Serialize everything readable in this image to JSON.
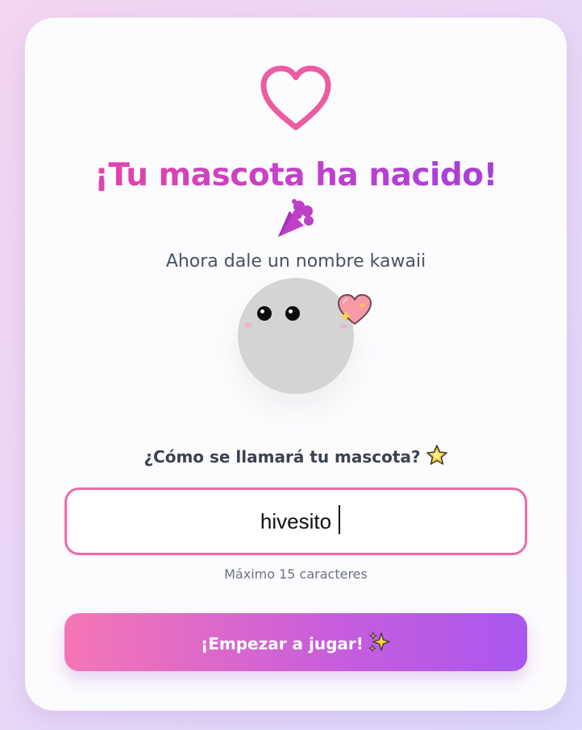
{
  "card": {
    "title": "¡Tu mascota ha nacido!",
    "subtitle": "Ahora dale un nombre kawaii",
    "question": "¿Cómo se llamará tu mascota?",
    "name_input": {
      "value": "hivesito",
      "placeholder": ""
    },
    "helper": "Máximo 15 caracteres",
    "start_button": "¡Empezar a jugar!"
  },
  "icons": {
    "top": "heart-outline-icon",
    "title_emoji": "party-popper-icon",
    "pet_accent": "sparkling-heart-icon",
    "question_emoji": "glowing-star-icon",
    "button_emoji": "sparkles-icon"
  },
  "colors": {
    "accent_pink": "#ec4899",
    "accent_purple": "#a855f7",
    "pet_body": "#d4d4d4",
    "input_border": "#f06aa8"
  }
}
